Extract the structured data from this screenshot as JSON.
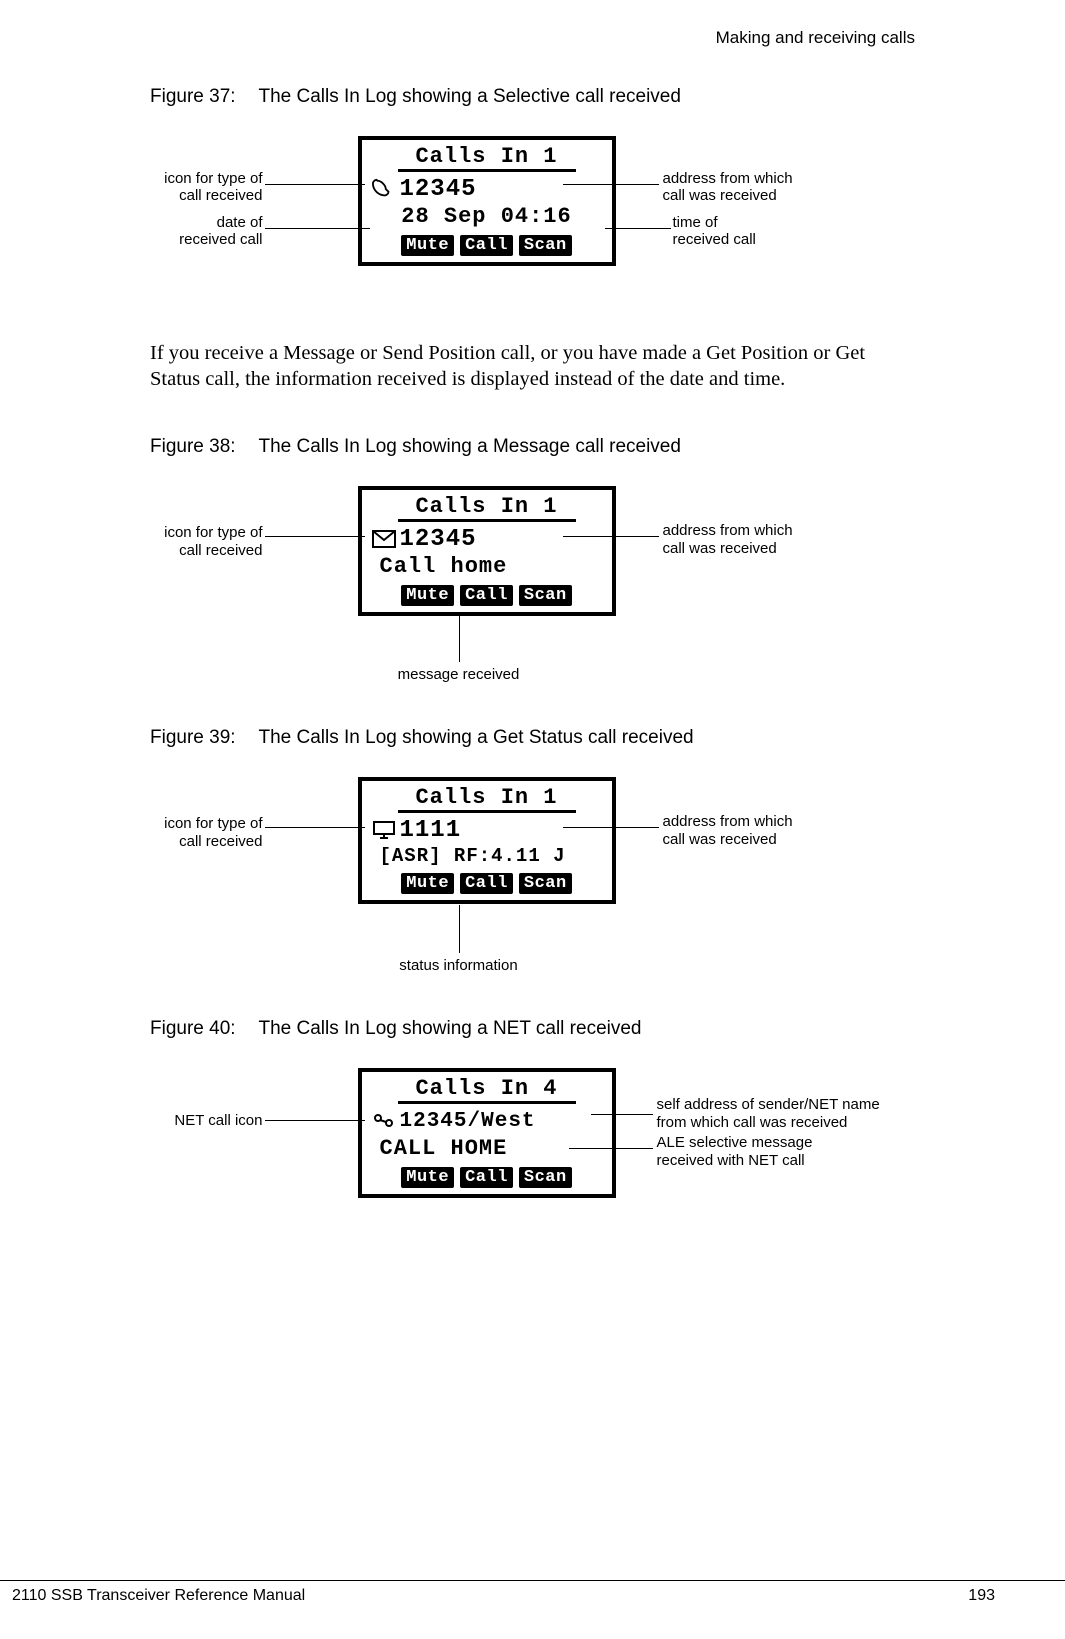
{
  "header": {
    "section_title": "Making and receiving calls"
  },
  "footer": {
    "manual_title": "2110 SSB Transceiver Reference Manual",
    "page_number": "193"
  },
  "fig37": {
    "caption_num": "Figure 37:",
    "caption_text": "The Calls In Log showing a Selective call received",
    "lcd_title": "Calls In 1",
    "icon_name": "phone-icon",
    "address": "12345",
    "datetime": "28 Sep 04:16",
    "softkeys": [
      "Mute",
      "Call",
      "Scan"
    ],
    "callouts": {
      "icon_type": "icon for type of\ncall received",
      "address_from": "address from which\ncall was received",
      "date_of": "date of\nreceived call",
      "time_of": "time of\nreceived call"
    }
  },
  "para1": "If you receive a Message or Send Position call, or you have made a Get Position or Get Status call, the information received is displayed instead of the date and time.",
  "fig38": {
    "caption_num": "Figure 38:",
    "caption_text": "The Calls In Log showing a Message call received",
    "lcd_title": "Calls In 1",
    "icon_name": "envelope-icon",
    "address": "12345",
    "message": "Call home",
    "softkeys": [
      "Mute",
      "Call",
      "Scan"
    ],
    "callouts": {
      "icon_type": "icon for type of\ncall received",
      "address_from": "address from which\ncall was received",
      "message_received": "message received"
    }
  },
  "fig39": {
    "caption_num": "Figure 39:",
    "caption_text": "The Calls In Log showing a Get Status call received",
    "lcd_title": "Calls In 1",
    "icon_name": "monitor-icon",
    "address": "1111",
    "status": "[ASR] RF:4.11 J",
    "softkeys": [
      "Mute",
      "Call",
      "Scan"
    ],
    "callouts": {
      "icon_type": "icon for type of\ncall received",
      "address_from": "address from which\ncall was received",
      "status_info": "status information"
    }
  },
  "fig40": {
    "caption_num": "Figure 40:",
    "caption_text": "The Calls In Log showing a NET call received",
    "lcd_title": "Calls In 4",
    "icon_name": "net-icon",
    "address": "12345/West",
    "message": "CALL HOME",
    "softkeys": [
      "Mute",
      "Call",
      "Scan"
    ],
    "callouts": {
      "net_icon": "NET call icon",
      "self_addr": "self address of sender/NET name\nfrom which call was received",
      "ale_msg": "ALE selective message\nreceived with NET call"
    }
  }
}
